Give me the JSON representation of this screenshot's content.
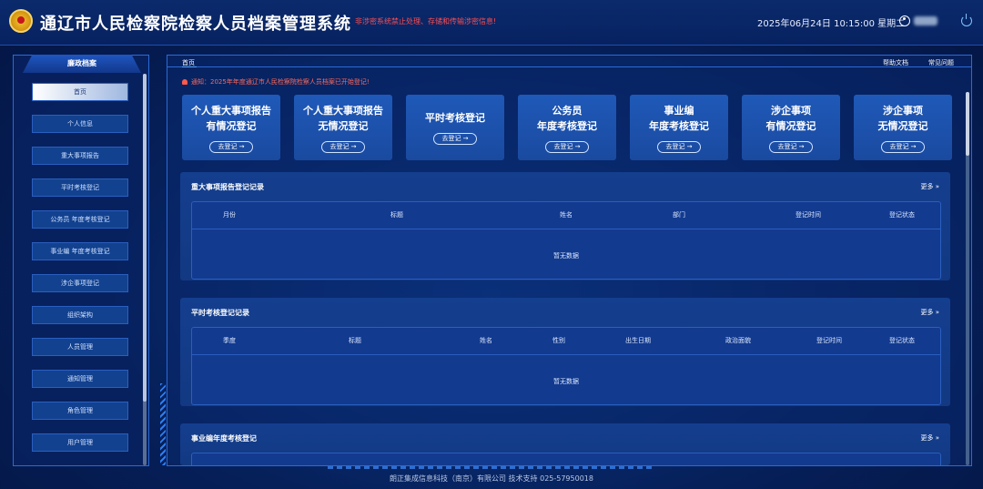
{
  "header": {
    "title": "通辽市人民检察院检察人员档案管理系统",
    "warning": "非涉密系统禁止处理、存储和传输涉密信息!",
    "datetime": "2025年06月24日 10:15:00 星期二"
  },
  "sidebar": {
    "heading": "廉政档案",
    "items": [
      {
        "label": "首页"
      },
      {
        "label": "个人信息"
      },
      {
        "label": "重大事项报告"
      },
      {
        "label": "平时考核登记"
      },
      {
        "label": "公务员 年度考核登记"
      },
      {
        "label": "事业编 年度考核登记"
      },
      {
        "label": "涉企事项登记"
      },
      {
        "label": "组织架构"
      },
      {
        "label": "人员管理"
      },
      {
        "label": "通知管理"
      },
      {
        "label": "角色管理"
      },
      {
        "label": "用户管理"
      }
    ]
  },
  "tabs": {
    "home": "首页",
    "help": "帮助文档",
    "faq": "常见问题"
  },
  "notice": "通知：2025年年度通辽市人民检察院检察人员档案已开始登记!",
  "cards": [
    {
      "line1": "个人重大事项报告",
      "line2": "有情况登记",
      "button": "去登记 →"
    },
    {
      "line1": "个人重大事项报告",
      "line2": "无情况登记",
      "button": "去登记 →"
    },
    {
      "line1": "平时考核登记",
      "line2": "",
      "button": "去登记 →"
    },
    {
      "line1": "公务员",
      "line2": "年度考核登记",
      "button": "去登记 →"
    },
    {
      "line1": "事业编",
      "line2": "年度考核登记",
      "button": "去登记 →"
    },
    {
      "line1": "涉企事项",
      "line2": "有情况登记",
      "button": "去登记 →"
    },
    {
      "line1": "涉企事项",
      "line2": "无情况登记",
      "button": "去登记 →"
    }
  ],
  "sections": [
    {
      "title": "重大事项报告登记记录",
      "more": "更多 »",
      "columns": [
        "月份",
        "标题",
        "姓名",
        "部门",
        "登记时间",
        "登记状态"
      ],
      "empty": "暂无数据"
    },
    {
      "title": "平时考核登记记录",
      "more": "更多 »",
      "columns": [
        "季度",
        "标题",
        "姓名",
        "性别",
        "出生日期",
        "政治面貌",
        "登记时间",
        "登记状态"
      ],
      "empty": "暂无数据"
    },
    {
      "title": "事业编年度考核登记",
      "more": "更多 »"
    }
  ],
  "footer": "朗正集成信息科技（南京）有限公司 技术支持 025-57950018"
}
